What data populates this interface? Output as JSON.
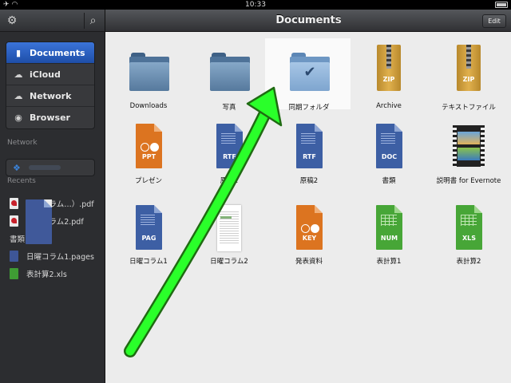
{
  "status_bar": {
    "time": "10:33"
  },
  "sidebar": {
    "nav": [
      {
        "label": "Documents",
        "icon": "document-icon",
        "active": true
      },
      {
        "label": "iCloud",
        "icon": "cloud-icon",
        "active": false
      },
      {
        "label": "Network",
        "icon": "network-cloud-icon",
        "active": false
      },
      {
        "label": "Browser",
        "icon": "compass-icon",
        "active": false
      }
    ],
    "network_label": "Network",
    "recents_label": "Recents",
    "recents": [
      {
        "label": "日曜コラム…）.pdf",
        "type": "pdf"
      },
      {
        "label": "日曜コラム2.pdf",
        "type": "pdf"
      },
      {
        "label": "書類.doc",
        "type": "doc"
      },
      {
        "label": "日曜コラム1.pages",
        "type": "pages"
      },
      {
        "label": "表計算2.xls",
        "type": "xls"
      }
    ]
  },
  "main": {
    "title": "Documents",
    "edit_label": "Edit",
    "items": [
      {
        "label": "Downloads",
        "kind": "folder"
      },
      {
        "label": "写真",
        "kind": "folder"
      },
      {
        "label": "同期フォルダ",
        "kind": "folder-synced",
        "selected": true
      },
      {
        "label": "Archive",
        "kind": "zip",
        "badge": "ZIP"
      },
      {
        "label": "テキストファイル",
        "kind": "zip",
        "badge": "ZIP"
      },
      {
        "label": "プレゼン",
        "kind": "ppt",
        "badge": "PPT"
      },
      {
        "label": "原稿1",
        "kind": "rtf",
        "badge": "RTF"
      },
      {
        "label": "原稿2",
        "kind": "rtf",
        "badge": "RTF"
      },
      {
        "label": "書類",
        "kind": "doc",
        "badge": "DOC"
      },
      {
        "label": "説明書 for Evernote",
        "kind": "video"
      },
      {
        "label": "日曜コラム1",
        "kind": "pages",
        "badge": "PAG"
      },
      {
        "label": "日曜コラム2",
        "kind": "preview"
      },
      {
        "label": "発表資料",
        "kind": "key",
        "badge": "KEY"
      },
      {
        "label": "表計算1",
        "kind": "num",
        "badge": "NUM"
      },
      {
        "label": "表計算2",
        "kind": "xls",
        "badge": "XLS"
      }
    ]
  },
  "annotation": {
    "color": "#2aff2a",
    "outline": "#1f6b12"
  }
}
